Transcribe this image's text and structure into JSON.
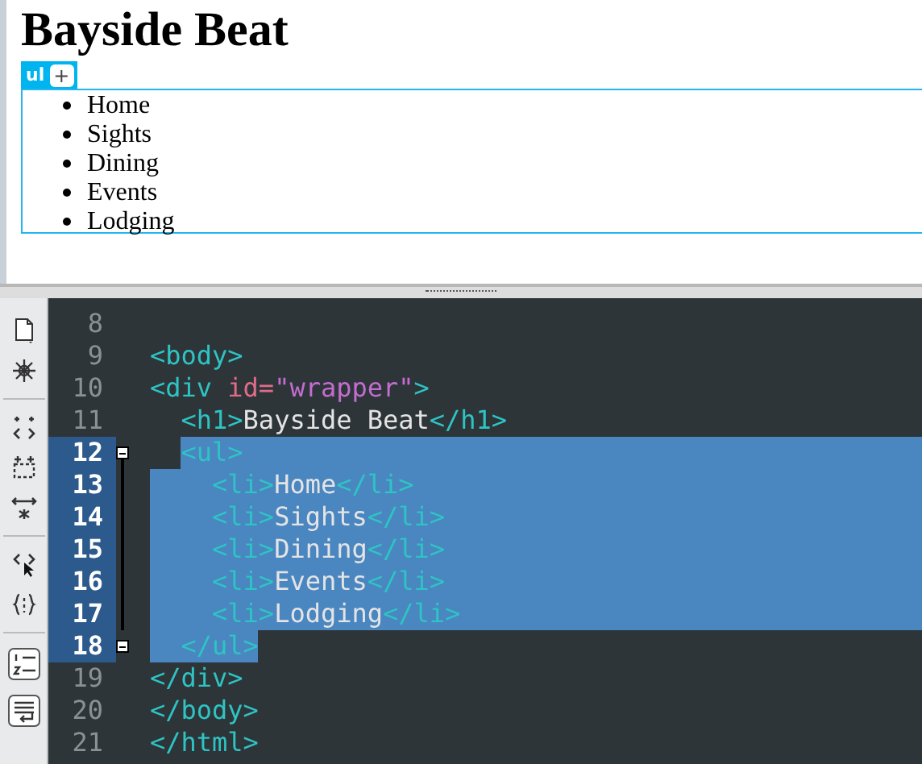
{
  "design_view": {
    "heading": "Bayside Beat",
    "tag_label": "ul",
    "add_button": "+",
    "list_items": [
      "Home",
      "Sights",
      "Dining",
      "Events",
      "Lodging"
    ]
  },
  "code_view": {
    "lines": [
      {
        "number": "8",
        "selected": false,
        "fold_marker": false
      },
      {
        "number": "9",
        "selected": false,
        "fold_marker": false,
        "tokens": [
          {
            "kind": "tag",
            "text": "<body>"
          }
        ]
      },
      {
        "number": "10",
        "selected": false,
        "fold_marker": false,
        "tokens": [
          {
            "kind": "tag",
            "text": "<div"
          },
          {
            "kind": "attr",
            "text": " id="
          },
          {
            "kind": "string",
            "text": "\"wrapper\""
          },
          {
            "kind": "tag",
            "text": ">"
          }
        ]
      },
      {
        "number": "11",
        "selected": false,
        "fold_marker": false,
        "tokens": [
          {
            "kind": "tag",
            "text": "  <h1>"
          },
          {
            "kind": "text",
            "text": "Bayside Beat"
          },
          {
            "kind": "tag",
            "text": "</h1>"
          }
        ]
      },
      {
        "number": "12",
        "selected": true,
        "fold_marker": true,
        "tokens": [
          {
            "kind": "tag",
            "text": "  <ul>"
          }
        ]
      },
      {
        "number": "13",
        "selected": true,
        "fold_marker": false,
        "tokens": [
          {
            "kind": "tag",
            "text": "    <li>"
          },
          {
            "kind": "text",
            "text": "Home"
          },
          {
            "kind": "tag",
            "text": "</li>"
          }
        ]
      },
      {
        "number": "14",
        "selected": true,
        "fold_marker": false,
        "tokens": [
          {
            "kind": "tag",
            "text": "    <li>"
          },
          {
            "kind": "text",
            "text": "Sights"
          },
          {
            "kind": "tag",
            "text": "</li>"
          }
        ]
      },
      {
        "number": "15",
        "selected": true,
        "fold_marker": false,
        "tokens": [
          {
            "kind": "tag",
            "text": "    <li>"
          },
          {
            "kind": "text",
            "text": "Dining"
          },
          {
            "kind": "tag",
            "text": "</li>"
          }
        ]
      },
      {
        "number": "16",
        "selected": true,
        "fold_marker": false,
        "tokens": [
          {
            "kind": "tag",
            "text": "    <li>"
          },
          {
            "kind": "text",
            "text": "Events"
          },
          {
            "kind": "tag",
            "text": "</li>"
          }
        ]
      },
      {
        "number": "17",
        "selected": true,
        "fold_marker": false,
        "tokens": [
          {
            "kind": "tag",
            "text": "    <li>"
          },
          {
            "kind": "text",
            "text": "Lodging"
          },
          {
            "kind": "tag",
            "text": "</li>"
          }
        ]
      },
      {
        "number": "18",
        "selected": true,
        "fold_marker": true,
        "tokens": [
          {
            "kind": "tag",
            "text": "  </ul>"
          }
        ]
      },
      {
        "number": "19",
        "selected": false,
        "fold_marker": false,
        "tokens": [
          {
            "kind": "tag",
            "text": "</div>"
          }
        ]
      },
      {
        "number": "20",
        "selected": false,
        "fold_marker": false,
        "tokens": [
          {
            "kind": "tag",
            "text": "</body>"
          }
        ]
      },
      {
        "number": "21",
        "selected": false,
        "fold_marker": false,
        "tokens": [
          {
            "kind": "tag",
            "text": "</html>"
          }
        ]
      }
    ]
  }
}
